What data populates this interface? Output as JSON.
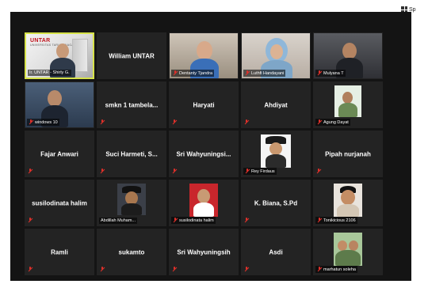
{
  "header": {
    "speaker_view_label": "Sp"
  },
  "branding": {
    "logo_text": "UNTAR",
    "logo_sub": "UNIVERSITAS TARUMANAGARA"
  },
  "participants": [
    {
      "name": "Ir. UNTAR - Shirly G.",
      "kind": "video",
      "muted": false,
      "active": true
    },
    {
      "name": "William UNTAR",
      "kind": "name",
      "muted": false
    },
    {
      "name": "Dentanty Tjandra",
      "kind": "video",
      "muted": true
    },
    {
      "name": "Luthfi Handayani",
      "kind": "video",
      "muted": true
    },
    {
      "name": "Mulyana T",
      "kind": "video",
      "muted": true
    },
    {
      "name": "windows 10",
      "kind": "video",
      "muted": true
    },
    {
      "name": "smkn 1 tambela...",
      "kind": "name",
      "muted": true
    },
    {
      "name": "Haryati",
      "kind": "name",
      "muted": true
    },
    {
      "name": "Ahdiyat",
      "kind": "name",
      "muted": true
    },
    {
      "name": "Agung Dayat",
      "kind": "photo",
      "muted": true
    },
    {
      "name": "Fajar Anwari",
      "kind": "name",
      "muted": true
    },
    {
      "name": "Suci Harmeti, S...",
      "kind": "name",
      "muted": true
    },
    {
      "name": "Sri Wahyuningsi...",
      "kind": "name",
      "muted": true
    },
    {
      "name": "Rey Firdaus",
      "kind": "photo",
      "muted": true
    },
    {
      "name": "Pipah nurjanah",
      "kind": "name",
      "muted": true
    },
    {
      "name": "susilodinata halim",
      "kind": "name",
      "muted": true
    },
    {
      "name": "Abdillah Muham...",
      "kind": "photo",
      "muted": true
    },
    {
      "name": "susilodinata halim",
      "kind": "photo",
      "muted": true
    },
    {
      "name": "K. Biana, S.Pd",
      "kind": "name",
      "muted": true
    },
    {
      "name": "Tonikicious 2106",
      "kind": "photo",
      "muted": true
    },
    {
      "name": "Ramli",
      "kind": "name",
      "muted": true
    },
    {
      "name": "sukamto",
      "kind": "name",
      "muted": true
    },
    {
      "name": "Sri Wahyuningsih",
      "kind": "name",
      "muted": true
    },
    {
      "name": "Asdi",
      "kind": "name",
      "muted": true
    },
    {
      "name": "marhatun soleha",
      "kind": "photo",
      "muted": true
    }
  ],
  "colors": {
    "background": "#141414",
    "tile": "#232323",
    "active_border": "#d6e24a",
    "muted_icon": "#e0302a",
    "text": "#ffffff"
  }
}
